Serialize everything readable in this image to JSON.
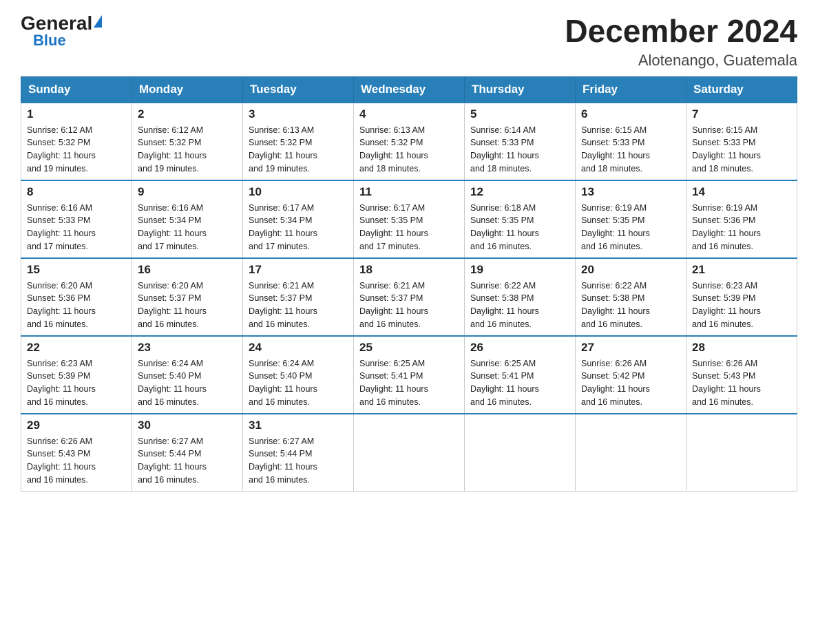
{
  "logo": {
    "general": "General",
    "blue": "Blue",
    "triangle": ""
  },
  "title": {
    "month_year": "December 2024",
    "location": "Alotenango, Guatemala"
  },
  "headers": [
    "Sunday",
    "Monday",
    "Tuesday",
    "Wednesday",
    "Thursday",
    "Friday",
    "Saturday"
  ],
  "weeks": [
    [
      {
        "day": "1",
        "sunrise": "6:12 AM",
        "sunset": "5:32 PM",
        "daylight": "11 hours and 19 minutes."
      },
      {
        "day": "2",
        "sunrise": "6:12 AM",
        "sunset": "5:32 PM",
        "daylight": "11 hours and 19 minutes."
      },
      {
        "day": "3",
        "sunrise": "6:13 AM",
        "sunset": "5:32 PM",
        "daylight": "11 hours and 19 minutes."
      },
      {
        "day": "4",
        "sunrise": "6:13 AM",
        "sunset": "5:32 PM",
        "daylight": "11 hours and 18 minutes."
      },
      {
        "day": "5",
        "sunrise": "6:14 AM",
        "sunset": "5:33 PM",
        "daylight": "11 hours and 18 minutes."
      },
      {
        "day": "6",
        "sunrise": "6:15 AM",
        "sunset": "5:33 PM",
        "daylight": "11 hours and 18 minutes."
      },
      {
        "day": "7",
        "sunrise": "6:15 AM",
        "sunset": "5:33 PM",
        "daylight": "11 hours and 18 minutes."
      }
    ],
    [
      {
        "day": "8",
        "sunrise": "6:16 AM",
        "sunset": "5:33 PM",
        "daylight": "11 hours and 17 minutes."
      },
      {
        "day": "9",
        "sunrise": "6:16 AM",
        "sunset": "5:34 PM",
        "daylight": "11 hours and 17 minutes."
      },
      {
        "day": "10",
        "sunrise": "6:17 AM",
        "sunset": "5:34 PM",
        "daylight": "11 hours and 17 minutes."
      },
      {
        "day": "11",
        "sunrise": "6:17 AM",
        "sunset": "5:35 PM",
        "daylight": "11 hours and 17 minutes."
      },
      {
        "day": "12",
        "sunrise": "6:18 AM",
        "sunset": "5:35 PM",
        "daylight": "11 hours and 16 minutes."
      },
      {
        "day": "13",
        "sunrise": "6:19 AM",
        "sunset": "5:35 PM",
        "daylight": "11 hours and 16 minutes."
      },
      {
        "day": "14",
        "sunrise": "6:19 AM",
        "sunset": "5:36 PM",
        "daylight": "11 hours and 16 minutes."
      }
    ],
    [
      {
        "day": "15",
        "sunrise": "6:20 AM",
        "sunset": "5:36 PM",
        "daylight": "11 hours and 16 minutes."
      },
      {
        "day": "16",
        "sunrise": "6:20 AM",
        "sunset": "5:37 PM",
        "daylight": "11 hours and 16 minutes."
      },
      {
        "day": "17",
        "sunrise": "6:21 AM",
        "sunset": "5:37 PM",
        "daylight": "11 hours and 16 minutes."
      },
      {
        "day": "18",
        "sunrise": "6:21 AM",
        "sunset": "5:37 PM",
        "daylight": "11 hours and 16 minutes."
      },
      {
        "day": "19",
        "sunrise": "6:22 AM",
        "sunset": "5:38 PM",
        "daylight": "11 hours and 16 minutes."
      },
      {
        "day": "20",
        "sunrise": "6:22 AM",
        "sunset": "5:38 PM",
        "daylight": "11 hours and 16 minutes."
      },
      {
        "day": "21",
        "sunrise": "6:23 AM",
        "sunset": "5:39 PM",
        "daylight": "11 hours and 16 minutes."
      }
    ],
    [
      {
        "day": "22",
        "sunrise": "6:23 AM",
        "sunset": "5:39 PM",
        "daylight": "11 hours and 16 minutes."
      },
      {
        "day": "23",
        "sunrise": "6:24 AM",
        "sunset": "5:40 PM",
        "daylight": "11 hours and 16 minutes."
      },
      {
        "day": "24",
        "sunrise": "6:24 AM",
        "sunset": "5:40 PM",
        "daylight": "11 hours and 16 minutes."
      },
      {
        "day": "25",
        "sunrise": "6:25 AM",
        "sunset": "5:41 PM",
        "daylight": "11 hours and 16 minutes."
      },
      {
        "day": "26",
        "sunrise": "6:25 AM",
        "sunset": "5:41 PM",
        "daylight": "11 hours and 16 minutes."
      },
      {
        "day": "27",
        "sunrise": "6:26 AM",
        "sunset": "5:42 PM",
        "daylight": "11 hours and 16 minutes."
      },
      {
        "day": "28",
        "sunrise": "6:26 AM",
        "sunset": "5:43 PM",
        "daylight": "11 hours and 16 minutes."
      }
    ],
    [
      {
        "day": "29",
        "sunrise": "6:26 AM",
        "sunset": "5:43 PM",
        "daylight": "11 hours and 16 minutes."
      },
      {
        "day": "30",
        "sunrise": "6:27 AM",
        "sunset": "5:44 PM",
        "daylight": "11 hours and 16 minutes."
      },
      {
        "day": "31",
        "sunrise": "6:27 AM",
        "sunset": "5:44 PM",
        "daylight": "11 hours and 16 minutes."
      },
      null,
      null,
      null,
      null
    ]
  ],
  "labels": {
    "sunrise_prefix": "Sunrise: ",
    "sunset_prefix": "Sunset: ",
    "daylight_prefix": "Daylight: "
  }
}
